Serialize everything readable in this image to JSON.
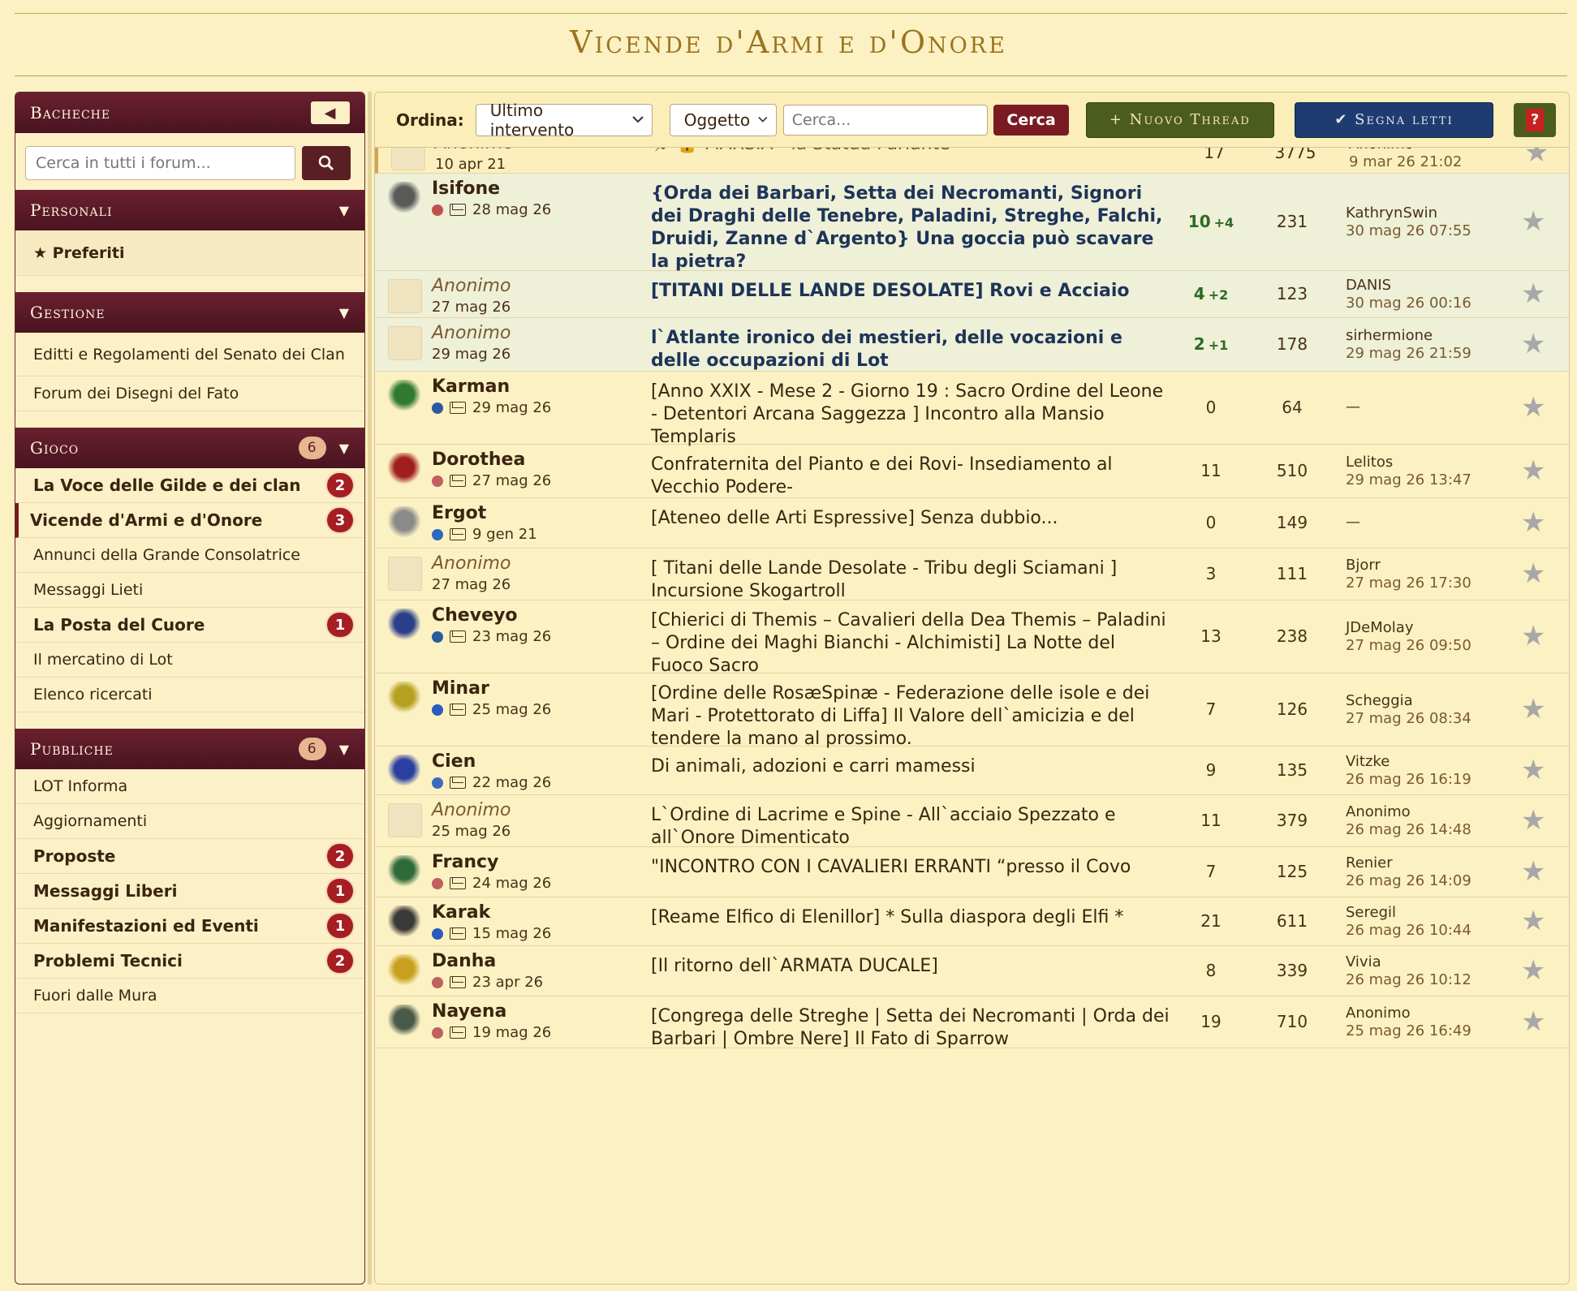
{
  "page_title": "Vicende d'Armi e d'Onore",
  "sidebar": {
    "bacheche": "Bacheche",
    "search_placeholder": "Cerca in tutti i forum...",
    "personali": "Personali",
    "preferiti": "★ Preferiti",
    "gestione": "Gestione",
    "gestione_items": [
      "Editti e Regolamenti del Senato dei Clan",
      "Forum dei Disegni del Fato"
    ],
    "gioco": "Gioco",
    "gioco_count": "6",
    "gioco_items": [
      {
        "label": "La Voce delle Gilde e dei clan",
        "badge": "2"
      },
      {
        "label": "Vicende d'Armi e d'Onore",
        "badge": "3"
      },
      {
        "label": "Annunci della Grande Consolatrice",
        "badge": ""
      },
      {
        "label": "Messaggi Lieti",
        "badge": ""
      },
      {
        "label": "La Posta del Cuore",
        "badge": "1"
      },
      {
        "label": "Il mercatino di Lot",
        "badge": ""
      },
      {
        "label": "Elenco ricercati",
        "badge": ""
      }
    ],
    "pubbliche": "Pubbliche",
    "pubbliche_count": "6",
    "pubbliche_items": [
      {
        "label": "LOT Informa",
        "badge": ""
      },
      {
        "label": "Aggiornamenti",
        "badge": ""
      },
      {
        "label": "Proposte",
        "badge": "2"
      },
      {
        "label": "Messaggi Liberi",
        "badge": "1"
      },
      {
        "label": "Manifestazioni ed Eventi",
        "badge": "1"
      },
      {
        "label": "Problemi Tecnici",
        "badge": "2"
      },
      {
        "label": "Fuori dalle Mura",
        "badge": ""
      }
    ]
  },
  "toolbar": {
    "sort_label": "Ordina:",
    "sort_value": "Ultimo intervento",
    "field_value": "Oggetto",
    "search_placeholder": "Cerca...",
    "search_button": "Cerca",
    "new_thread": "+ Nuovo Thread",
    "mark_read": "✔ Segna letti",
    "help": "?"
  },
  "threads": [
    {
      "author": "Anonimo",
      "date": "10 apr 21",
      "title": "🖈 🔒 MARSIA - la Statua Parlante",
      "replies": "17",
      "new": "",
      "views": "3775",
      "last_user": "Anonimo",
      "last_date": "9 mar 26 21:02"
    },
    {
      "author": "Isifone",
      "date": "28 mag 26",
      "title": "{Orda dei Barbari, Setta dei Necromanti, Signori dei Draghi delle Tenebre, Paladini, Streghe, Falchi, Druidi, Zanne d`Argento} Una goccia può scavare la pietra?",
      "replies": "10",
      "new": "+4",
      "views": "231",
      "last_user": "KathrynSwin",
      "last_date": "30 mag 26 07:55"
    },
    {
      "author": "Anonimo",
      "date": "27 mag 26",
      "title": "[TITANI DELLE LANDE DESOLATE] Rovi e Acciaio",
      "replies": "4",
      "new": "+2",
      "views": "123",
      "last_user": "DANIS",
      "last_date": "30 mag 26 00:16"
    },
    {
      "author": "Anonimo",
      "date": "29 mag 26",
      "title": "l`Atlante ironico dei mestieri, delle vocazioni e delle occupazioni di Lot",
      "replies": "2",
      "new": "+1",
      "views": "178",
      "last_user": "sirhermione",
      "last_date": "29 mag 26 21:59"
    },
    {
      "author": "Karman",
      "date": "29 mag 26",
      "title": "[Anno XXIX - Mese 2 - Giorno 19 : Sacro Ordine del Leone - Detentori Arcana Saggezza ] Incontro alla Mansio Templaris",
      "replies": "0",
      "new": "",
      "views": "64",
      "last_user": "—",
      "last_date": ""
    },
    {
      "author": "Dorothea",
      "date": "27 mag 26",
      "title": "Confraternita del Pianto e dei Rovi- Insediamento al Vecchio Podere-",
      "replies": "11",
      "new": "",
      "views": "510",
      "last_user": "Lelitos",
      "last_date": "29 mag 26 13:47"
    },
    {
      "author": "Ergot",
      "date": "9 gen 21",
      "title": "[Ateneo delle Arti Espressive] Senza dubbio...",
      "replies": "0",
      "new": "",
      "views": "149",
      "last_user": "—",
      "last_date": ""
    },
    {
      "author": "Anonimo",
      "date": "27 mag 26",
      "title": "[ Titani delle Lande Desolate - Tribu degli Sciamani ] Incursione Skogartroll",
      "replies": "3",
      "new": "",
      "views": "111",
      "last_user": "Bjorr",
      "last_date": "27 mag 26 17:30"
    },
    {
      "author": "Cheveyo",
      "date": "23 mag 26",
      "title": "[Chierici di Themis – Cavalieri della Dea Themis – Paladini – Ordine dei Maghi Bianchi - Alchimisti] La Notte del Fuoco Sacro",
      "replies": "13",
      "new": "",
      "views": "238",
      "last_user": "JDeMolay",
      "last_date": "27 mag 26 09:50"
    },
    {
      "author": "Minar",
      "date": "25 mag 26",
      "title": "[Ordine delle RosæSpinæ - Federazione delle isole e dei Mari - Protettorato di Liffa] Il Valore dell`amicizia e del tendere la mano al prossimo.",
      "replies": "7",
      "new": "",
      "views": "126",
      "last_user": "Scheggia",
      "last_date": "27 mag 26 08:34"
    },
    {
      "author": "Cien",
      "date": "22 mag 26",
      "title": "Di animali, adozioni e carri mamessi",
      "replies": "9",
      "new": "",
      "views": "135",
      "last_user": "Vitzke",
      "last_date": "26 mag 26 16:19"
    },
    {
      "author": "Anonimo",
      "date": "25 mag 26",
      "title": "L`Ordine di Lacrime e Spine - All`acciaio Spezzato e all`Onore Dimenticato",
      "replies": "11",
      "new": "",
      "views": "379",
      "last_user": "Anonimo",
      "last_date": "26 mag 26 14:48"
    },
    {
      "author": "Francy",
      "date": "24 mag 26",
      "title": "\"INCONTRO CON I CAVALIERI ERRANTI “presso il Covo",
      "replies": "7",
      "new": "",
      "views": "125",
      "last_user": "Renier",
      "last_date": "26 mag 26 14:09"
    },
    {
      "author": "Karak",
      "date": "15 mag 26",
      "title": "[Reame Elfico di Elenillor] * Sulla diaspora degli Elfi *",
      "replies": "21",
      "new": "",
      "views": "611",
      "last_user": "Seregil",
      "last_date": "26 mag 26 10:44"
    },
    {
      "author": "Danha",
      "date": "23 apr 26",
      "title": "[Il ritorno dell`ARMATA DUCALE]",
      "replies": "8",
      "new": "",
      "views": "339",
      "last_user": "Vivia",
      "last_date": "26 mag 26 10:12"
    },
    {
      "author": "Nayena",
      "date": "19 mag 26",
      "title": "[Congrega delle Streghe | Setta dei Necromanti | Orda dei Barbari | Ombre Nere] Il Fato di Sparrow",
      "replies": "19",
      "new": "",
      "views": "710",
      "last_user": "Anonimo",
      "last_date": "25 mag 26 16:49"
    }
  ]
}
